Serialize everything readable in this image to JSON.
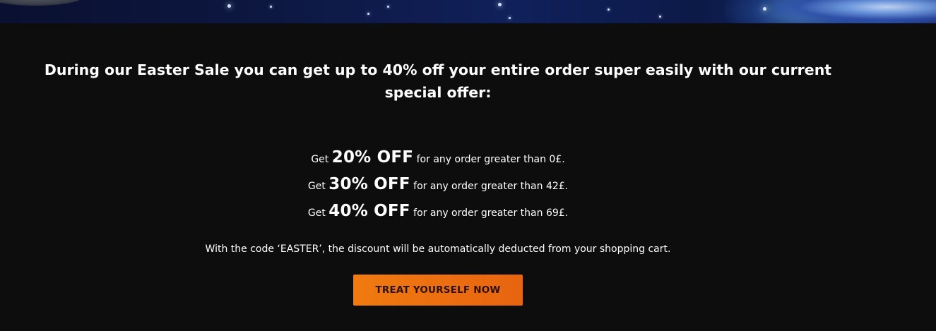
{
  "banner": {
    "alt": ""
  },
  "headline": "During our Easter Sale you can get up to 40% off your entire order super easily with our current special offer:",
  "offers": [
    {
      "prefix": "Get",
      "discount": "20% OFF",
      "suffix": "for any order greater than 0£."
    },
    {
      "prefix": "Get",
      "discount": "30% OFF",
      "suffix": "for any order greater than 42£."
    },
    {
      "prefix": "Get",
      "discount": "40% OFF",
      "suffix": "for any order greater than 69£."
    }
  ],
  "code_note": "With the code ‘EASTER’, the discount will be automatically deducted from your shopping cart.",
  "cta": {
    "label": "TREAT YOURSELF NOW"
  },
  "colors": {
    "background": "#0d0d0d",
    "text": "#ffffff",
    "cta_bg": "#f07a10",
    "cta_text": "#2b1200"
  }
}
